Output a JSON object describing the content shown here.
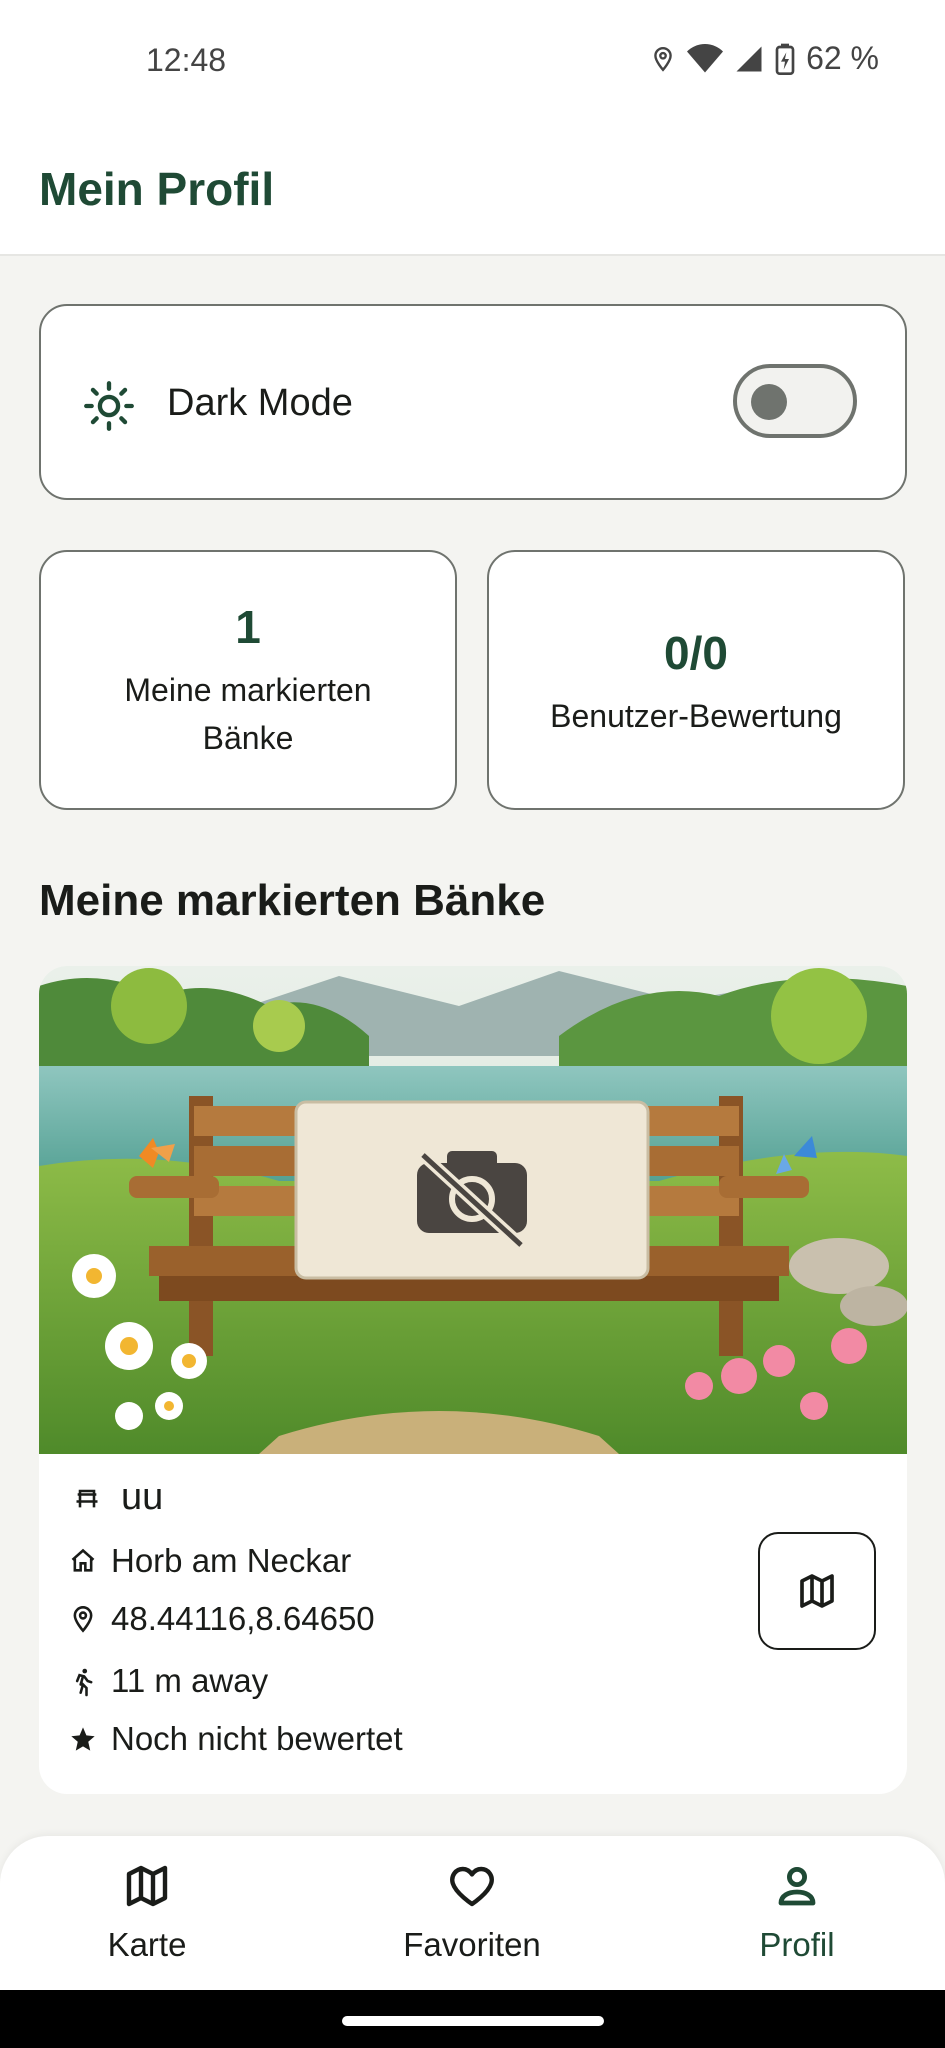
{
  "status_bar": {
    "time": "12:48",
    "battery": "62 %"
  },
  "header": {
    "title": "Mein Profil"
  },
  "settings": {
    "dark_mode_label": "Dark Mode",
    "dark_mode_enabled": false
  },
  "stats": [
    {
      "value": "1",
      "label": "Meine markierten Bänke"
    },
    {
      "value": "0/0",
      "label": "Benutzer-Bewertung"
    }
  ],
  "section": {
    "title": "Meine markierten Bänke"
  },
  "bench": {
    "name": "uu",
    "city": "Horb am Neckar",
    "coordinates": "48.44116,8.64650",
    "distance": "11 m away",
    "rating": "Noch nicht bewertet"
  },
  "nav": {
    "items": [
      {
        "label": "Karte",
        "icon": "map-icon"
      },
      {
        "label": "Favoriten",
        "icon": "heart-icon"
      },
      {
        "label": "Profil",
        "icon": "person-icon"
      }
    ],
    "active": "Profil"
  },
  "colors": {
    "accent": "#1f4a35",
    "background": "#f4f4f1",
    "outline": "#6f736e"
  }
}
